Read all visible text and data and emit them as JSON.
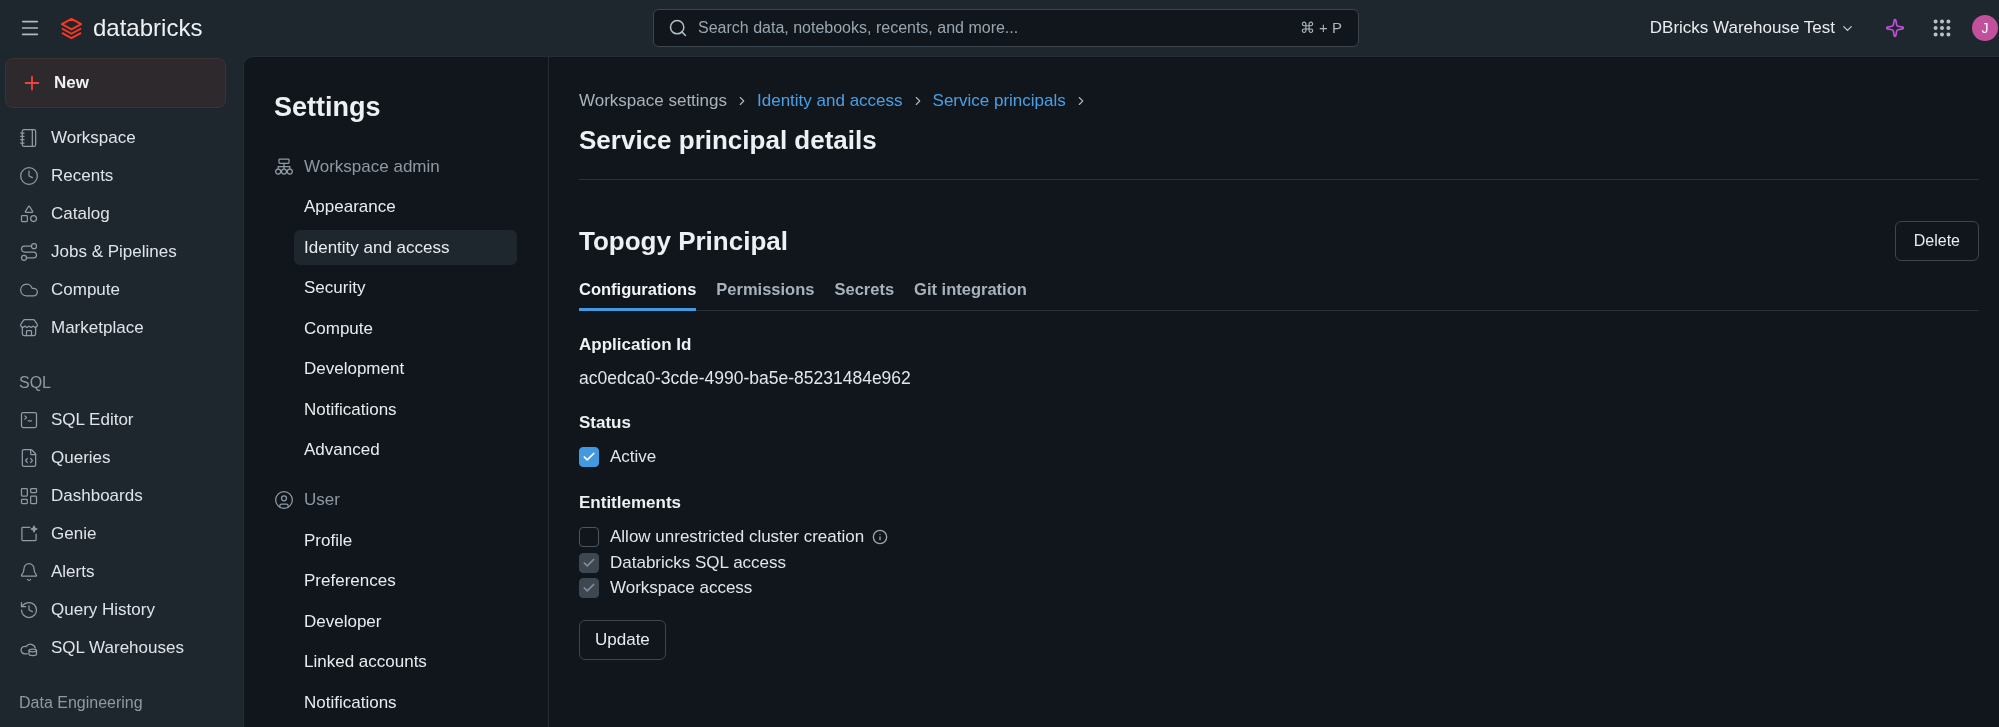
{
  "top_bar": {
    "logo_text": "databricks",
    "search": {
      "placeholder": "Search data, notebooks, recents, and more...",
      "shortcut": "⌘ + P"
    },
    "workspace": "DBricks Warehouse Test",
    "avatar": "J"
  },
  "sidebar": {
    "new_button": "New",
    "sections": [
      {
        "items": [
          "Workspace",
          "Recents",
          "Catalog",
          "Jobs & Pipelines",
          "Compute",
          "Marketplace"
        ]
      },
      {
        "header": "SQL",
        "items": [
          "SQL Editor",
          "Queries",
          "Dashboards",
          "Genie",
          "Alerts",
          "Query History",
          "SQL Warehouses"
        ]
      },
      {
        "header": "Data Engineering"
      }
    ]
  },
  "settings_nav": {
    "title": "Settings",
    "sections": [
      {
        "header": "Workspace admin",
        "items": [
          {
            "label": "Appearance",
            "selected": false
          },
          {
            "label": "Identity and access",
            "selected": true
          },
          {
            "label": "Security",
            "selected": false
          },
          {
            "label": "Compute",
            "selected": false
          },
          {
            "label": "Development",
            "selected": false
          },
          {
            "label": "Notifications",
            "selected": false
          },
          {
            "label": "Advanced",
            "selected": false
          }
        ]
      },
      {
        "header": "User",
        "items": [
          {
            "label": "Profile",
            "selected": false
          },
          {
            "label": "Preferences",
            "selected": false
          },
          {
            "label": "Developer",
            "selected": false
          },
          {
            "label": "Linked accounts",
            "selected": false
          },
          {
            "label": "Notifications",
            "selected": false
          }
        ]
      }
    ]
  },
  "content": {
    "breadcrumb": [
      {
        "label": "Workspace settings",
        "link": false
      },
      {
        "label": "Identity and access",
        "link": true
      },
      {
        "label": "Service principals",
        "link": true
      }
    ],
    "page_title": "Service principal details",
    "principal_name": "Topogy Principal",
    "delete_button": "Delete",
    "tabs": [
      {
        "label": "Configurations",
        "selected": true
      },
      {
        "label": "Permissions",
        "selected": false
      },
      {
        "label": "Secrets",
        "selected": false
      },
      {
        "label": "Git integration",
        "selected": false
      }
    ],
    "application_id": {
      "label": "Application Id",
      "value": "ac0edca0-3cde-4990-ba5e-85231484e962"
    },
    "status": {
      "label": "Status",
      "checkbox": {
        "label": "Active",
        "checked": true
      }
    },
    "entitlements": {
      "label": "Entitlements",
      "items": [
        {
          "label": "Allow unrestricted cluster creation",
          "checked": false,
          "disabled": false,
          "info": true
        },
        {
          "label": "Databricks SQL access",
          "checked": true,
          "disabled": true,
          "info": false
        },
        {
          "label": "Workspace access",
          "checked": true,
          "disabled": true,
          "info": false
        }
      ]
    },
    "update_button": "Update"
  }
}
